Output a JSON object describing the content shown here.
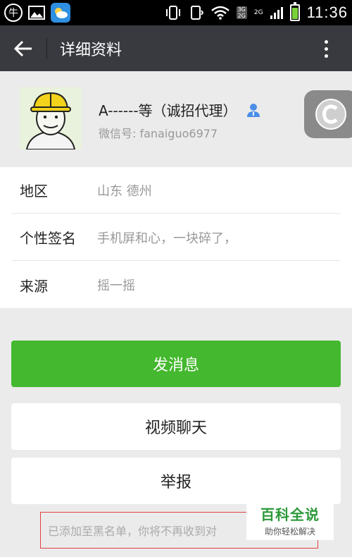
{
  "status_bar": {
    "left_icon_glyph": "牛",
    "net_top": "3G",
    "net_bottom": "2G",
    "net_second": "2G",
    "time": "11:36",
    "icons": [
      "niu-app-icon",
      "gallery-icon",
      "weather-icon",
      "vibrate-icon",
      "screen-rotate-icon",
      "wifi-icon",
      "signal-icon",
      "battery-icon"
    ]
  },
  "title_bar": {
    "title": "详细资料"
  },
  "profile": {
    "name": "A------等（诚招代理）",
    "wechat_id": "微信号: fanaiguo6977"
  },
  "info": {
    "region_label": "地区",
    "region_value": "山东  德州",
    "signature_label": "个性签名",
    "signature_value": "手机屏和心，一块碎了，",
    "source_label": "来源",
    "source_value": "摇一摇"
  },
  "actions": {
    "send_message": "发消息",
    "video_chat": "视频聊天",
    "report": "举报"
  },
  "notice": {
    "text": "已添加至黑名单，你将不再收到对"
  },
  "watermark": {
    "title": "百科全说",
    "subtitle": "助你轻松解决"
  },
  "colors": {
    "primary_green": "#44b82e",
    "title_bar": "#393a3f",
    "notice_border": "#e34040"
  }
}
